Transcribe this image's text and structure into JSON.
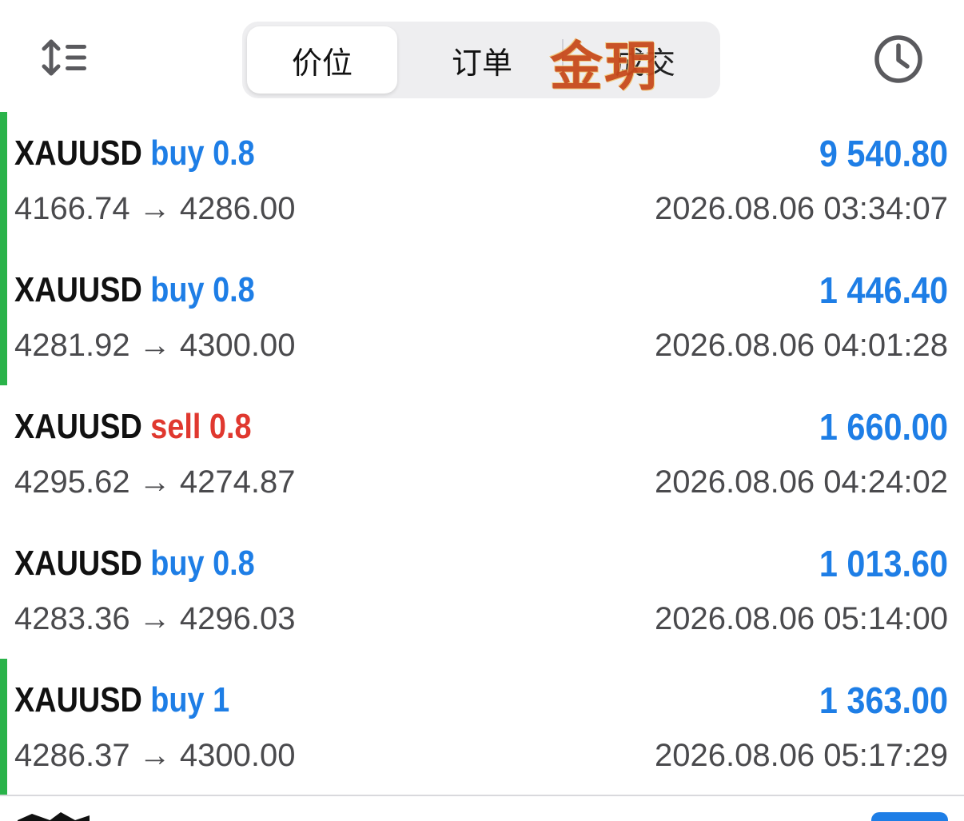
{
  "tabs": [
    {
      "label": "价位",
      "active": true
    },
    {
      "label": "订单",
      "active": false
    },
    {
      "label": "成交",
      "active": false
    }
  ],
  "watermark": "金玥",
  "icons": {
    "sort": "sort-icon",
    "history": "clock-icon"
  },
  "colors": {
    "buy": "#1e7ee6",
    "sell": "#e0382f",
    "profit": "#1e7ee6",
    "indicator": "#2ab34a"
  },
  "deals": [
    {
      "symbol": "XAUUSD",
      "side": "buy 0.8",
      "direction": "buy",
      "open_price": "4166.74",
      "arrow": "→",
      "close_price": "4286.00",
      "profit": "9 540.80",
      "time": "2026.08.06 03:34:07",
      "indicator": true
    },
    {
      "symbol": "XAUUSD",
      "side": "buy 0.8",
      "direction": "buy",
      "open_price": "4281.92",
      "arrow": "→",
      "close_price": "4300.00",
      "profit": "1 446.40",
      "time": "2026.08.06 04:01:28",
      "indicator": true
    },
    {
      "symbol": "XAUUSD",
      "side": "sell 0.8",
      "direction": "sell",
      "open_price": "4295.62",
      "arrow": "→",
      "close_price": "4274.87",
      "profit": "1 660.00",
      "time": "2026.08.06 04:24:02",
      "indicator": false
    },
    {
      "symbol": "XAUUSD",
      "side": "buy 0.8",
      "direction": "buy",
      "open_price": "4283.36",
      "arrow": "→",
      "close_price": "4296.03",
      "profit": "1 013.60",
      "time": "2026.08.06 05:14:00",
      "indicator": false
    },
    {
      "symbol": "XAUUSD",
      "side": "buy 1",
      "direction": "buy",
      "open_price": "4286.37",
      "arrow": "→",
      "close_price": "4300.00",
      "profit": "1 363.00",
      "time": "2026.08.06 05:17:29",
      "indicator": true
    }
  ]
}
